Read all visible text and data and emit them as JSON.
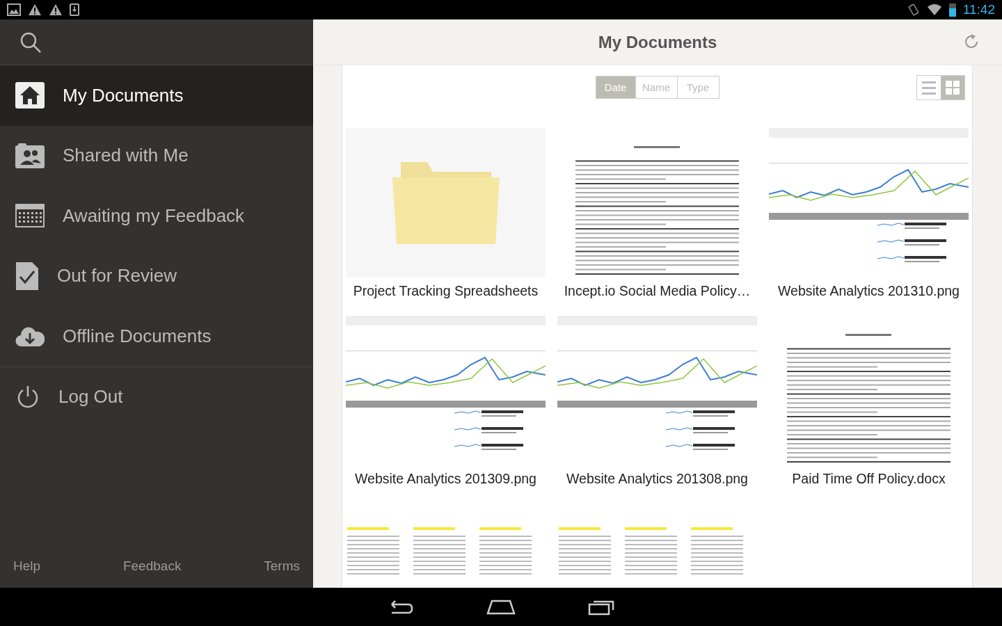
{
  "status_bar": {
    "time": "11:42"
  },
  "sidebar": {
    "items": [
      {
        "kind": "home",
        "label": "My Documents",
        "selected": true
      },
      {
        "kind": "people",
        "label": "Shared with Me",
        "selected": false
      },
      {
        "kind": "calendar",
        "label": "Awaiting my Feedback",
        "selected": false
      },
      {
        "kind": "check-doc",
        "label": "Out for Review",
        "selected": false
      },
      {
        "kind": "cloud",
        "label": "Offline Documents",
        "selected": false
      },
      {
        "kind": "power",
        "label": "Log Out",
        "selected": false
      }
    ],
    "footer_links": [
      "Help",
      "Feedback",
      "Terms"
    ]
  },
  "header": {
    "title": "My Documents"
  },
  "sort_tabs": [
    {
      "label": "Date",
      "selected": true
    },
    {
      "label": "Name",
      "selected": false
    },
    {
      "label": "Type",
      "selected": false
    }
  ],
  "view_toggle": [
    {
      "kind": "list",
      "selected": false
    },
    {
      "kind": "grid",
      "selected": true
    }
  ],
  "documents": [
    {
      "kind": "folder",
      "name": "Project Tracking Spreadsheets"
    },
    {
      "kind": "document",
      "name": "Incept.io Social Media Policy…"
    },
    {
      "kind": "chart",
      "name": "Website Analytics 201310.png"
    },
    {
      "kind": "chart",
      "name": "Website Analytics 201309.png"
    },
    {
      "kind": "chart",
      "name": "Website Analytics 201308.png"
    },
    {
      "kind": "document",
      "name": "Paid Time Off Policy.docx"
    },
    {
      "kind": "spreadsheet"
    },
    {
      "kind": "spreadsheet"
    }
  ]
}
